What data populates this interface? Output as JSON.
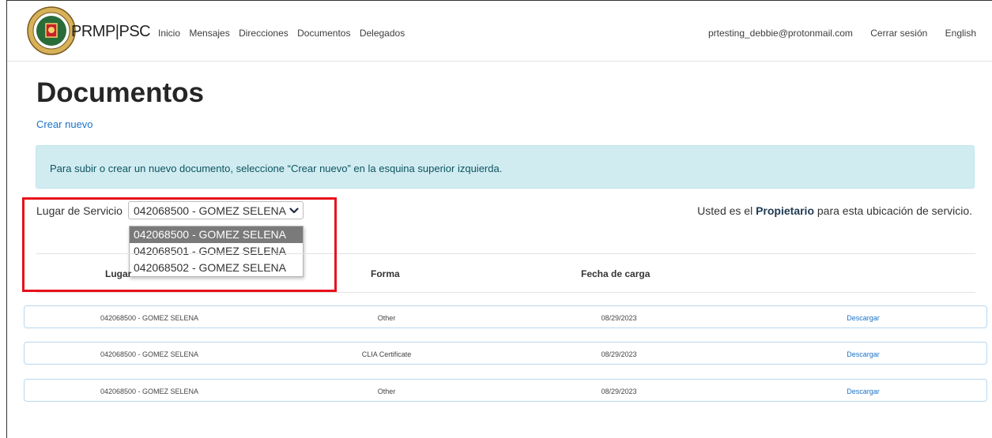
{
  "nav": {
    "brand": "PRMP|PSC",
    "links": [
      "Inicio",
      "Mensajes",
      "Direcciones",
      "Documentos",
      "Delegados"
    ],
    "user_email": "prtesting_debbie@protonmail.com",
    "logout": "Cerrar sesión",
    "language": "English"
  },
  "page": {
    "title": "Documentos",
    "create_link": "Crear nuevo",
    "info": "Para subir o crear un nuevo documento, seleccione “Crear nuevo” en la esquina superior izquierda."
  },
  "service": {
    "label": "Lugar de Servicio",
    "selected": "042068500 - GOMEZ SELENA",
    "options": [
      "042068500 - GOMEZ SELENA",
      "042068501 - GOMEZ SELENA",
      "042068502 - GOMEZ SELENA"
    ],
    "role_prefix": "Usted es el",
    "role": "Propietario",
    "role_suffix": "para esta ubicación de servicio."
  },
  "table": {
    "headers": [
      "Lugar",
      "Forma",
      "Fecha de carga"
    ],
    "rows": [
      {
        "lugar": "042068500 - GOMEZ SELENA",
        "forma": "Other",
        "fecha": "08/29/2023",
        "action": "Descargar"
      },
      {
        "lugar": "042068500 - GOMEZ SELENA",
        "forma": "CLIA Certificate",
        "fecha": "08/29/2023",
        "action": "Descargar"
      },
      {
        "lugar": "042068500 - GOMEZ SELENA",
        "forma": "Other",
        "fecha": "08/29/2023",
        "action": "Descargar"
      }
    ]
  },
  "colors": {
    "accent": "#1a73c9",
    "alert_bg": "#d1ecf1",
    "highlight": "#e8101b"
  }
}
